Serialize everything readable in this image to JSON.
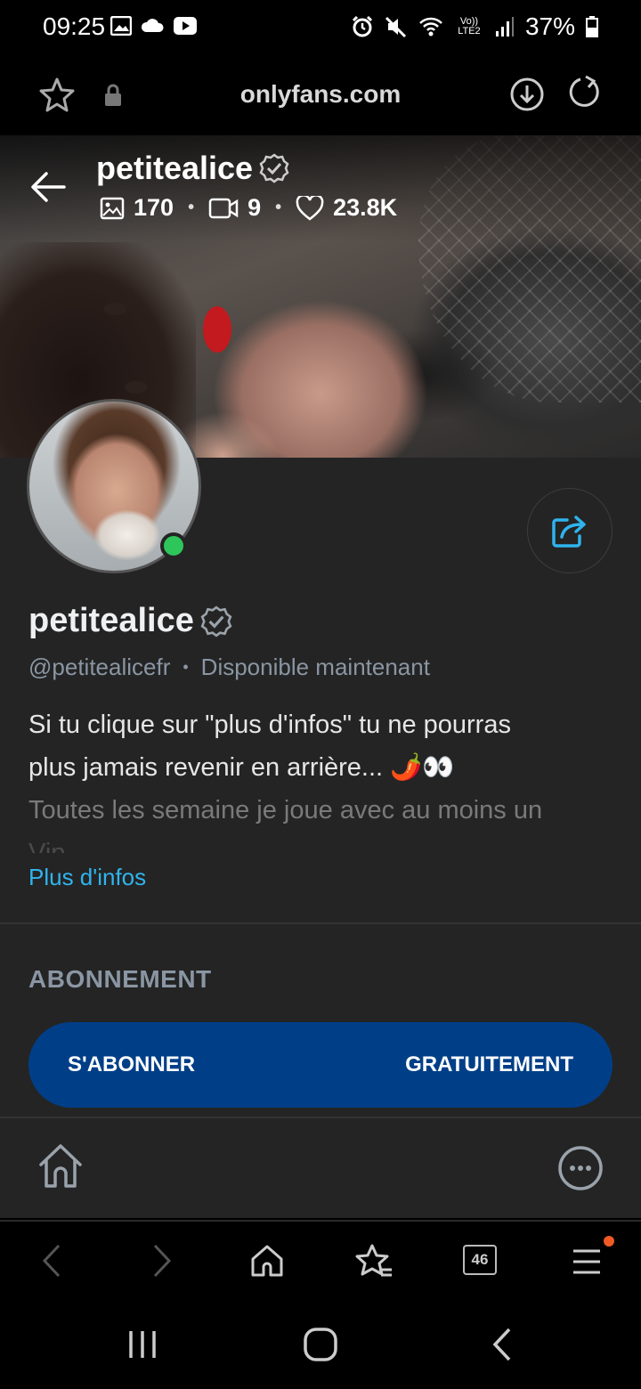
{
  "status_bar": {
    "time": "09:25",
    "battery": "37%",
    "icons": [
      "gallery-icon",
      "cloud-icon",
      "youtube-icon",
      "alarm-icon",
      "mute-icon",
      "wifi-icon",
      "volte-icon",
      "signal-icon",
      "battery-icon"
    ],
    "volte_label": "Vo)) LTE2"
  },
  "browser": {
    "url": "onlyfans.com",
    "tab_count": "46"
  },
  "cover": {
    "username": "petitealice",
    "photos_count": "170",
    "videos_count": "9",
    "likes_count": "23.8K",
    "separator": "•"
  },
  "profile": {
    "display_name": "petitealice",
    "handle": "@petitealicefr",
    "separator": "•",
    "status": "Disponible maintenant",
    "bio_line1": "Si tu clique sur \"plus d'infos\" tu ne pourras",
    "bio_line2": "plus jamais revenir en arrière... 🌶️👀",
    "bio_line3": "Toutes les semaine je joue avec au moins un",
    "bio_line4": "Vip ... ...",
    "more_link": "Plus d'infos",
    "online": true
  },
  "subscription": {
    "section_title": "ABONNEMENT",
    "button_left": "S'ABONNER",
    "button_right": "GRATUITEMENT"
  },
  "colors": {
    "accent_blue": "#2fb4ee",
    "subscribe_button": "#003f87",
    "online_green": "#2ec55b",
    "card_bg": "#242424"
  }
}
